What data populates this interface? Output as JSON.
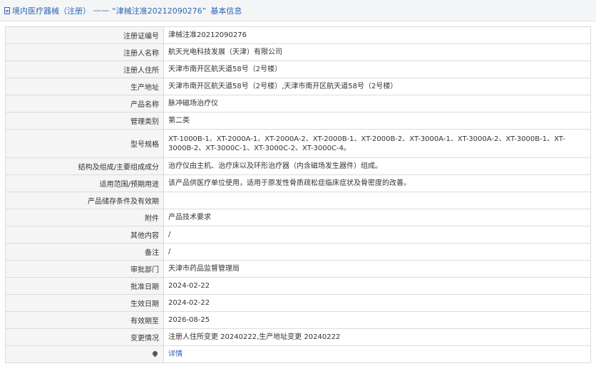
{
  "header": {
    "breadcrumb_label": "境内医疗器械（注册）",
    "separator": "——",
    "title": "“津械注准20212090276”",
    "suffix": "基本信息"
  },
  "rows": [
    {
      "label": "注册证编号",
      "value": "津械注准20212090276"
    },
    {
      "label": "注册人名称",
      "value": "航天光电科技发展（天津）有限公司"
    },
    {
      "label": "注册人住所",
      "value": "天津市南开区航天道58号（2号楼）"
    },
    {
      "label": "生产地址",
      "value": "天津市南开区航天道58号（2号楼）,天津市南开区航天道58号（2号楼）"
    },
    {
      "label": "产品名称",
      "value": "脉冲磁场治疗仪"
    },
    {
      "label": "管理类别",
      "value": "第二类"
    },
    {
      "label": "型号规格",
      "value": "XT-1000B-1、XT-2000A-1、XT-2000A-2、XT-2000B-1、XT-2000B-2、XT-3000A-1、XT-3000A-2、XT-3000B-1、XT-3000B-2、XT-3000C-1、XT-3000C-2、XT-3000C-4。"
    },
    {
      "label": "结构及组成/主要组成成分",
      "value": "治疗仪由主机、治疗床以及环形治疗器（内含磁场发生器件）组成。"
    },
    {
      "label": "适用范围/预期用途",
      "value": "该产品供医疗单位使用，适用于原发性骨质疏松症临床症状及骨密度的改善。"
    },
    {
      "label": "产品储存条件及有效期",
      "value": ""
    },
    {
      "label": "附件",
      "value": "产品技术要求"
    },
    {
      "label": "其他内容",
      "value": "/"
    },
    {
      "label": "备注",
      "value": "/"
    },
    {
      "label": "审批部门",
      "value": "天津市药品监督管理局"
    },
    {
      "label": "批准日期",
      "value": "2024-02-22"
    },
    {
      "label": "生效日期",
      "value": "2024-02-22"
    },
    {
      "label": "有效期至",
      "value": "2026-08-25"
    },
    {
      "label": "变更情况",
      "value": "注册人住所变更 20240222,生产地址变更 20240222"
    }
  ],
  "detail_row": {
    "icon": "location-pin-icon",
    "link_label": "详情"
  }
}
